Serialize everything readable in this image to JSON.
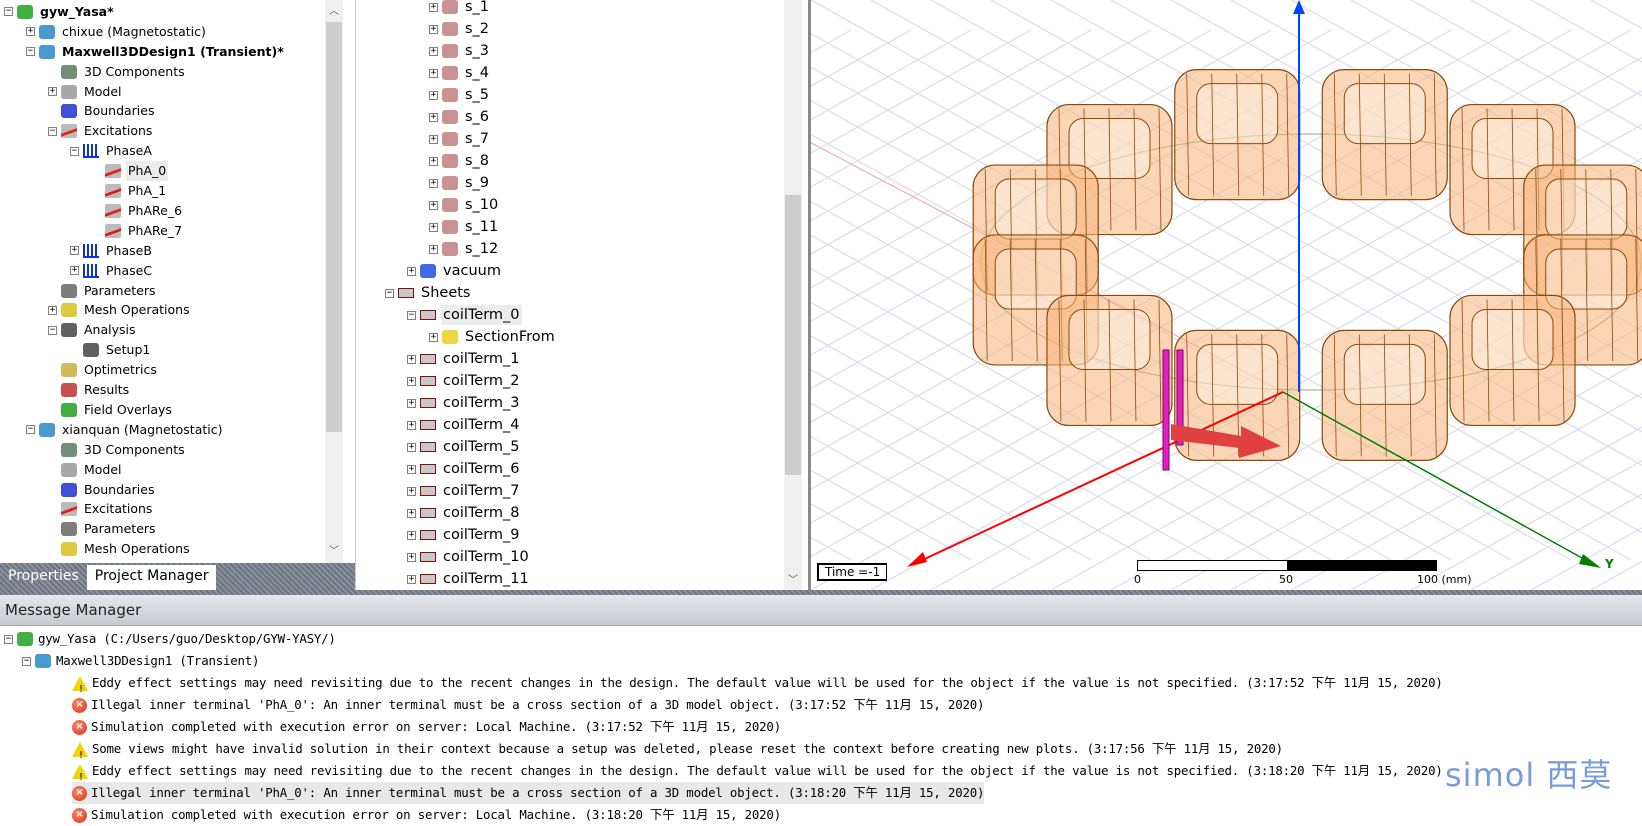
{
  "project_tree": [
    {
      "label": "gyw_Yasa*",
      "lvl": 0,
      "exp": "-",
      "icon": "project-icon",
      "bold": true
    },
    {
      "label": "chixue (Magnetostatic)",
      "lvl": 1,
      "exp": "+",
      "icon": "maxwell-design-icon"
    },
    {
      "label": "Maxwell3DDesign1 (Transient)*",
      "lvl": 1,
      "exp": "-",
      "icon": "maxwell-design-icon",
      "bold": true
    },
    {
      "label": "3D Components",
      "lvl": 2,
      "exp": "",
      "icon": "3d-components-icon"
    },
    {
      "label": "Model",
      "lvl": 2,
      "exp": "+",
      "icon": "model-icon"
    },
    {
      "label": "Boundaries",
      "lvl": 2,
      "exp": "",
      "icon": "boundaries-icon"
    },
    {
      "label": "Excitations",
      "lvl": 2,
      "exp": "-",
      "icon": "excitations-icon"
    },
    {
      "label": "PhaseA",
      "lvl": 3,
      "exp": "-",
      "icon": "winding-icon"
    },
    {
      "label": "PhA_0",
      "lvl": 4,
      "exp": "",
      "icon": "excitations-icon",
      "selected": true
    },
    {
      "label": "PhA_1",
      "lvl": 4,
      "exp": "",
      "icon": "excitations-icon"
    },
    {
      "label": "PhARe_6",
      "lvl": 4,
      "exp": "",
      "icon": "excitations-icon"
    },
    {
      "label": "PhARe_7",
      "lvl": 4,
      "exp": "",
      "icon": "excitations-icon"
    },
    {
      "label": "PhaseB",
      "lvl": 3,
      "exp": "+",
      "icon": "winding-icon"
    },
    {
      "label": "PhaseC",
      "lvl": 3,
      "exp": "+",
      "icon": "winding-icon"
    },
    {
      "label": "Parameters",
      "lvl": 2,
      "exp": "",
      "icon": "parameters-icon"
    },
    {
      "label": "Mesh Operations",
      "lvl": 2,
      "exp": "+",
      "icon": "mesh-operations-icon"
    },
    {
      "label": "Analysis",
      "lvl": 2,
      "exp": "-",
      "icon": "analysis-icon"
    },
    {
      "label": "Setup1",
      "lvl": 3,
      "exp": "",
      "icon": "analysis-icon"
    },
    {
      "label": "Optimetrics",
      "lvl": 2,
      "exp": "",
      "icon": "optimetrics-icon"
    },
    {
      "label": "Results",
      "lvl": 2,
      "exp": "",
      "icon": "results-icon"
    },
    {
      "label": "Field Overlays",
      "lvl": 2,
      "exp": "",
      "icon": "field-overlays-icon"
    },
    {
      "label": "xianquan (Magnetostatic)",
      "lvl": 1,
      "exp": "-",
      "icon": "maxwell-design-icon"
    },
    {
      "label": "3D Components",
      "lvl": 2,
      "exp": "",
      "icon": "3d-components-icon"
    },
    {
      "label": "Model",
      "lvl": 2,
      "exp": "",
      "icon": "model-icon"
    },
    {
      "label": "Boundaries",
      "lvl": 2,
      "exp": "",
      "icon": "boundaries-icon"
    },
    {
      "label": "Excitations",
      "lvl": 2,
      "exp": "",
      "icon": "excitations-icon"
    },
    {
      "label": "Parameters",
      "lvl": 2,
      "exp": "",
      "icon": "parameters-icon"
    },
    {
      "label": "Mesh Operations",
      "lvl": 2,
      "exp": "",
      "icon": "mesh-operations-icon"
    }
  ],
  "bottom_tabs": [
    {
      "label": "Properties"
    },
    {
      "label": "Project Manager",
      "active": true
    }
  ],
  "model_tree": [
    {
      "label": "s_1",
      "lvl": 3,
      "exp": "+",
      "icon": "solid-icon"
    },
    {
      "label": "s_2",
      "lvl": 3,
      "exp": "+",
      "icon": "solid-icon"
    },
    {
      "label": "s_3",
      "lvl": 3,
      "exp": "+",
      "icon": "solid-icon"
    },
    {
      "label": "s_4",
      "lvl": 3,
      "exp": "+",
      "icon": "solid-icon"
    },
    {
      "label": "s_5",
      "lvl": 3,
      "exp": "+",
      "icon": "solid-icon"
    },
    {
      "label": "s_6",
      "lvl": 3,
      "exp": "+",
      "icon": "solid-icon"
    },
    {
      "label": "s_7",
      "lvl": 3,
      "exp": "+",
      "icon": "solid-icon"
    },
    {
      "label": "s_8",
      "lvl": 3,
      "exp": "+",
      "icon": "solid-icon"
    },
    {
      "label": "s_9",
      "lvl": 3,
      "exp": "+",
      "icon": "solid-icon"
    },
    {
      "label": "s_10",
      "lvl": 3,
      "exp": "+",
      "icon": "solid-icon"
    },
    {
      "label": "s_11",
      "lvl": 3,
      "exp": "+",
      "icon": "solid-icon"
    },
    {
      "label": "s_12",
      "lvl": 3,
      "exp": "+",
      "icon": "solid-icon"
    },
    {
      "label": "vacuum",
      "lvl": 2,
      "exp": "+",
      "icon": "material-icon"
    },
    {
      "label": "Sheets",
      "lvl": 1,
      "exp": "-",
      "icon": "sheet-icon"
    },
    {
      "label": "coilTerm_0",
      "lvl": 2,
      "exp": "-",
      "icon": "sheet-icon",
      "selected": true
    },
    {
      "label": "SectionFrom",
      "lvl": 3,
      "exp": "+",
      "icon": "section-icon"
    },
    {
      "label": "coilTerm_1",
      "lvl": 2,
      "exp": "+",
      "icon": "sheet-icon"
    },
    {
      "label": "coilTerm_2",
      "lvl": 2,
      "exp": "+",
      "icon": "sheet-icon"
    },
    {
      "label": "coilTerm_3",
      "lvl": 2,
      "exp": "+",
      "icon": "sheet-icon"
    },
    {
      "label": "coilTerm_4",
      "lvl": 2,
      "exp": "+",
      "icon": "sheet-icon"
    },
    {
      "label": "coilTerm_5",
      "lvl": 2,
      "exp": "+",
      "icon": "sheet-icon"
    },
    {
      "label": "coilTerm_6",
      "lvl": 2,
      "exp": "+",
      "icon": "sheet-icon"
    },
    {
      "label": "coilTerm_7",
      "lvl": 2,
      "exp": "+",
      "icon": "sheet-icon"
    },
    {
      "label": "coilTerm_8",
      "lvl": 2,
      "exp": "+",
      "icon": "sheet-icon"
    },
    {
      "label": "coilTerm_9",
      "lvl": 2,
      "exp": "+",
      "icon": "sheet-icon"
    },
    {
      "label": "coilTerm_10",
      "lvl": 2,
      "exp": "+",
      "icon": "sheet-icon"
    },
    {
      "label": "coilTerm_11",
      "lvl": 2,
      "exp": "+",
      "icon": "sheet-icon"
    }
  ],
  "viewport": {
    "time_label": "Time =-1",
    "scale_labels": [
      "0",
      "50",
      "100 (mm)"
    ],
    "axis_y_label": "Y",
    "colors": {
      "x_axis": "#ff0000",
      "y_axis": "#008000",
      "z_axis": "#0044ff",
      "coil_fill": "#f7b47a",
      "coil_edge": "#8b4a0a",
      "terminal": "#e020c0"
    }
  },
  "message_manager": {
    "title": "Message Manager",
    "project": "gyw_Yasa (C:/Users/guo/Desktop/GYW-YASY/)",
    "design": "Maxwell3DDesign1 (Transient)",
    "messages": [
      {
        "type": "warning",
        "text": "Eddy effect settings may need revisiting due to the recent changes in the design.  The default value will be used for the object if the value is not specified.  (3:17:52 下午  11月 15, 2020)"
      },
      {
        "type": "error",
        "text": "Illegal inner terminal 'PhA_0': An inner terminal must be a cross section of a 3D model object. (3:17:52 下午  11月 15, 2020)"
      },
      {
        "type": "error",
        "text": "Simulation completed with execution error on server: Local Machine. (3:17:52 下午  11月 15, 2020)"
      },
      {
        "type": "warning",
        "text": "Some views might have invalid solution in their context because a setup was deleted, please reset the context before creating new plots. (3:17:56 下午  11月 15, 2020)"
      },
      {
        "type": "warning",
        "text": "Eddy effect settings may need revisiting due to the recent changes in the design.  The default value will be used for the object if the value is not specified.  (3:18:20 下午  11月 15, 2020)"
      },
      {
        "type": "error",
        "text": "Illegal inner terminal 'PhA_0': An inner terminal must be a cross section of a 3D model object. (3:18:20 下午  11月 15, 2020)",
        "selected": true
      },
      {
        "type": "error",
        "text": "Simulation completed with execution error on server: Local Machine. (3:18:20 下午  11月 15, 2020)"
      }
    ]
  },
  "watermark": "simol 西莫"
}
